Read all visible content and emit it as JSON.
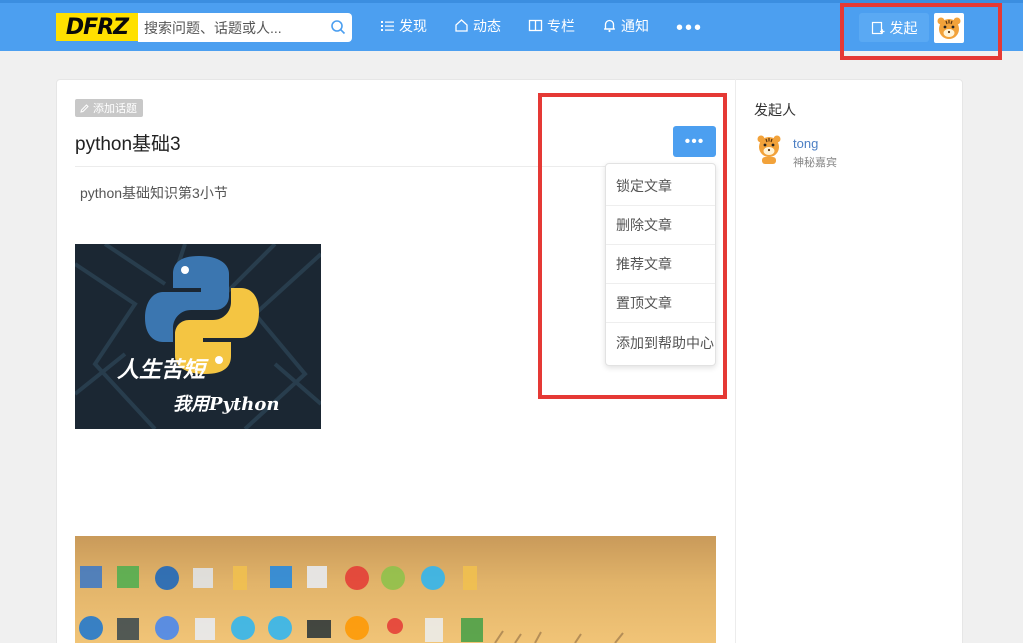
{
  "header": {
    "logo_text": "DFRZ",
    "search": {
      "placeholder": "搜索问题、话题或人..."
    },
    "nav": [
      {
        "label": "发现",
        "icon": "list-icon"
      },
      {
        "label": "动态",
        "icon": "home-icon"
      },
      {
        "label": "专栏",
        "icon": "columns-icon"
      },
      {
        "label": "通知",
        "icon": "bell-icon"
      }
    ],
    "more_label": "•••",
    "publish_label": "发起"
  },
  "article": {
    "topic_tag": "添加话题",
    "title": "python基础3",
    "more_label": "•••",
    "description": "python基础知识第3小节",
    "image_text": {
      "line1": "人生苦短",
      "line2": "我用Python"
    },
    "menu": [
      "锁定文章",
      "删除文章",
      "推荐文章",
      "置顶文章",
      "添加到帮助中心"
    ]
  },
  "sidebar": {
    "title": "发起人",
    "user": {
      "name": "tong",
      "description": "神秘嘉宾"
    }
  },
  "colors": {
    "brand": "#4c9ff0",
    "logo_bg": "#ffe000",
    "annotation_red": "#e53935"
  }
}
